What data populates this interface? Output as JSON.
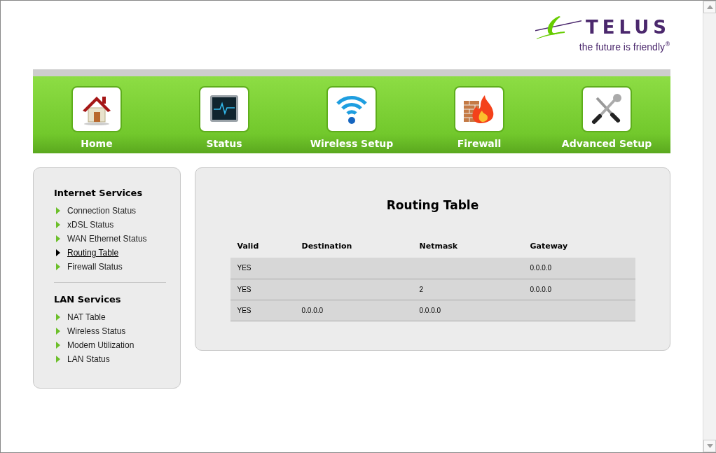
{
  "logo": {
    "brand": "TELUS",
    "tagline": "the future is friendly",
    "tagline_mark": "®"
  },
  "nav": [
    {
      "label": "Home",
      "kind": "home"
    },
    {
      "label": "Status",
      "kind": "status"
    },
    {
      "label": "Wireless Setup",
      "kind": "wireless"
    },
    {
      "label": "Firewall",
      "kind": "firewall"
    },
    {
      "label": "Advanced Setup",
      "kind": "tools"
    }
  ],
  "sidebar": {
    "sections": [
      {
        "title": "Internet Services",
        "items": [
          {
            "label": "Connection Status",
            "selected": false
          },
          {
            "label": "xDSL Status",
            "selected": false
          },
          {
            "label": "WAN Ethernet Status",
            "selected": false
          },
          {
            "label": "Routing Table",
            "selected": true
          },
          {
            "label": "Firewall Status",
            "selected": false
          }
        ]
      },
      {
        "title": "LAN Services",
        "items": [
          {
            "label": "NAT Table",
            "selected": false
          },
          {
            "label": "Wireless Status",
            "selected": false
          },
          {
            "label": "Modem Utilization",
            "selected": false
          },
          {
            "label": "LAN Status",
            "selected": false
          }
        ]
      }
    ]
  },
  "content": {
    "title": "Routing Table",
    "table": {
      "columns": [
        "Valid",
        "Destination",
        "Netmask",
        "Gateway"
      ],
      "rows": [
        [
          "YES",
          "",
          "",
          "0.0.0.0"
        ],
        [
          "YES",
          "",
          "2",
          "0.0.0.0"
        ],
        [
          "YES",
          "0.0.0.0",
          "0.0.0.0",
          ""
        ]
      ]
    }
  }
}
